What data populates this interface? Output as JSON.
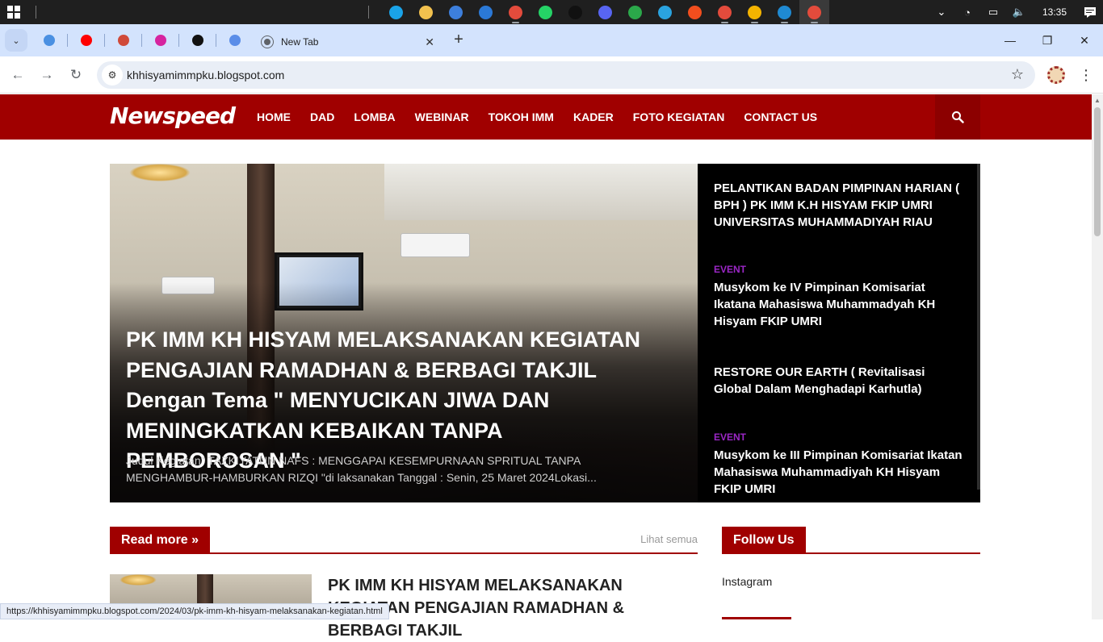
{
  "taskbar": {
    "apps": [
      {
        "name": "edge-icon",
        "color": "#1aa3e8"
      },
      {
        "name": "file-explorer-icon",
        "color": "#f2c14e"
      },
      {
        "name": "microsoft-store-icon",
        "color": "#3d7fdc"
      },
      {
        "name": "mail-icon",
        "color": "#2b79d6"
      },
      {
        "name": "chrome-icon",
        "color": "#e34b3c"
      },
      {
        "name": "whatsapp-icon",
        "color": "#25d366"
      },
      {
        "name": "tiktok-icon",
        "color": "#111111"
      },
      {
        "name": "discord-icon",
        "color": "#5865f2"
      },
      {
        "name": "chrome-profile-icon",
        "color": "#2ba84a"
      },
      {
        "name": "telegram-icon",
        "color": "#2aa3df"
      },
      {
        "name": "figma-icon",
        "color": "#f24e1e"
      },
      {
        "name": "chrome-profile-2-icon",
        "color": "#e34b3c"
      },
      {
        "name": "chrome-profile-3-icon",
        "color": "#f4b400"
      },
      {
        "name": "vscode-icon",
        "color": "#1f8ad2"
      },
      {
        "name": "chrome-active-icon",
        "color": "#e34b3c"
      }
    ],
    "tray": {
      "chevron": "⌄",
      "wifi": "◔",
      "battery": "▭",
      "volume": "🔈"
    },
    "clock": "13:35"
  },
  "browser": {
    "tabs": [
      {
        "name": "tab-1",
        "color": "#4a90e2"
      },
      {
        "name": "tab-youtube",
        "color": "#ff0000"
      },
      {
        "name": "tab-blog-active-small",
        "color": "#d04a3a"
      },
      {
        "name": "tab-instagram",
        "color": "#d6249f"
      },
      {
        "name": "tab-tiktok",
        "color": "#111111"
      },
      {
        "name": "tab-6",
        "color": "#5a8de8"
      }
    ],
    "active_tab_title": "New Tab",
    "url": "khhisyamimmpku.blogspot.com"
  },
  "site": {
    "logo": "Newspeed",
    "nav": [
      "HOME",
      "DAD",
      "LOMBA",
      "WEBINAR",
      "TOKOH IMM",
      "KADER",
      "FOTO KEGIATAN",
      "CONTACT US"
    ],
    "accent": "#a00000"
  },
  "featured": {
    "title": "PK IMM KH HISYAM MELAKSANAKAN KEGIATAN PENGAJIAN RAMADHAN & BERBAGI TAKJIL Dengan Tema \" MENYUCIKAN JIWA DAN MENINGKATKAN KEBAIKAN TANPA PEMBOROSAN \"",
    "excerpt": "Judul Kegiatan\" TAZKIYATUN NAFS : MENGGAPAI KESEMPURNAAN SPRITUAL TANPA MENGHAMBUR-HAMBURKAN RIZQI \"di laksanakan Tanggal : Senin, 25 Maret 2024Lokasi..."
  },
  "side_posts": [
    {
      "category": "",
      "title": "PELANTIKAN BADAN PIMPINAN HARIAN ( BPH ) PK IMM K.H HISYAM FKIP UMRI UNIVERSITAS MUHAMMADIYAH RIAU"
    },
    {
      "category": "EVENT",
      "title": "Musykom ke IV Pimpinan Komisariat Ikatana Mahasiswa Muhammadyah KH Hisyam FKIP UMRI"
    },
    {
      "category": "",
      "title": "RESTORE OUR EARTH ( Revitalisasi Global Dalam Menghadapi Karhutla)"
    },
    {
      "category": "EVENT",
      "title": "Musykom ke III Pimpinan Komisariat Ikatan Mahasiswa Muhammadiyah KH Hisyam FKIP UMRI"
    }
  ],
  "sections": {
    "read_more": "Read more »",
    "see_all": "Lihat semua",
    "follow_us": "Follow Us",
    "instagram": "Instagram"
  },
  "post_list": [
    {
      "title": "PK IMM KH HISYAM MELAKSANAKAN KEGIATAN PENGAJIAN RAMADHAN & BERBAGI TAKJIL"
    }
  ],
  "status_url": "https://khhisyamimmpku.blogspot.com/2024/03/pk-imm-kh-hisyam-melaksanakan-kegiatan.html"
}
